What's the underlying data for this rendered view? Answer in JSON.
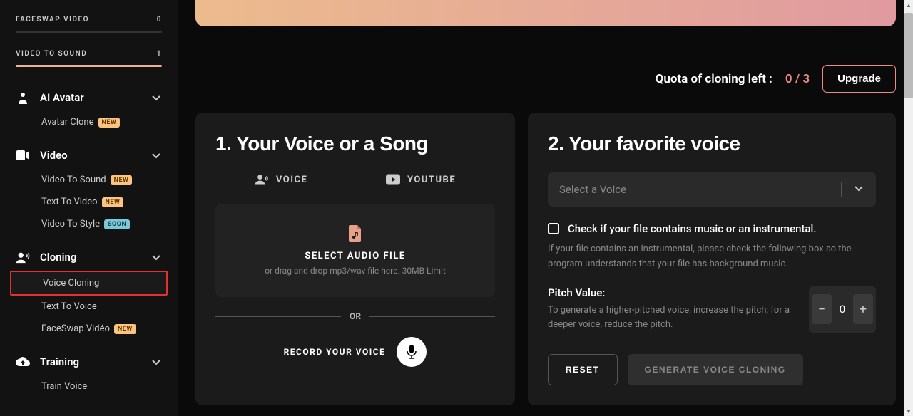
{
  "sidebar": {
    "progress": [
      {
        "label": "FACESWAP VIDEO",
        "count": "0",
        "pct": 0
      },
      {
        "label": "VIDEO TO SOUND",
        "count": "1",
        "pct": 100
      }
    ],
    "sections": [
      {
        "label": "AI Avatar",
        "icon": "person-icon",
        "items": [
          {
            "label": "Avatar Clone",
            "badge": "NEW",
            "badge_cls": "badge-new"
          }
        ]
      },
      {
        "label": "Video",
        "icon": "video-icon",
        "items": [
          {
            "label": "Video To Sound",
            "badge": "NEW",
            "badge_cls": "badge-new"
          },
          {
            "label": "Text To Video",
            "badge": "NEW",
            "badge_cls": "badge-new"
          },
          {
            "label": "Video To Style",
            "badge": "SOON",
            "badge_cls": "badge-soon"
          }
        ]
      },
      {
        "label": "Cloning",
        "icon": "voice-icon",
        "items": [
          {
            "label": "Voice Cloning",
            "active": true
          },
          {
            "label": "Text To Voice"
          },
          {
            "label": "FaceSwap Vidéo",
            "badge": "NEW",
            "badge_cls": "badge-new"
          }
        ]
      },
      {
        "label": "Training",
        "icon": "cloud-up-icon",
        "items": [
          {
            "label": "Train Voice"
          }
        ]
      }
    ]
  },
  "quota": {
    "label": "Quota of cloning left :",
    "value": "0 / 3",
    "upgrade": "Upgrade"
  },
  "step1": {
    "title": "1. Your Voice or a Song",
    "tab_voice": "VOICE",
    "tab_youtube": "YOUTUBE",
    "drop_title": "SELECT AUDIO FILE",
    "drop_hint": "or drag and drop mp3/wav file here. 30MB Limit",
    "or": "OR",
    "record_label": "RECORD YOUR VOICE"
  },
  "step2": {
    "title": "2. Your favorite voice",
    "select_placeholder": "Select a Voice",
    "check_label": "Check if your file contains music or an instrumental.",
    "check_hint": "If your file contains an instrumental, please check the following box so the program understands that your file has background music.",
    "pitch_label": "Pitch Value:",
    "pitch_hint": "To generate a higher-pitched voice, increase the pitch; for a deeper voice, reduce the pitch.",
    "pitch_value": "0",
    "reset": "RESET",
    "generate": "GENERATE VOICE CLONING"
  }
}
